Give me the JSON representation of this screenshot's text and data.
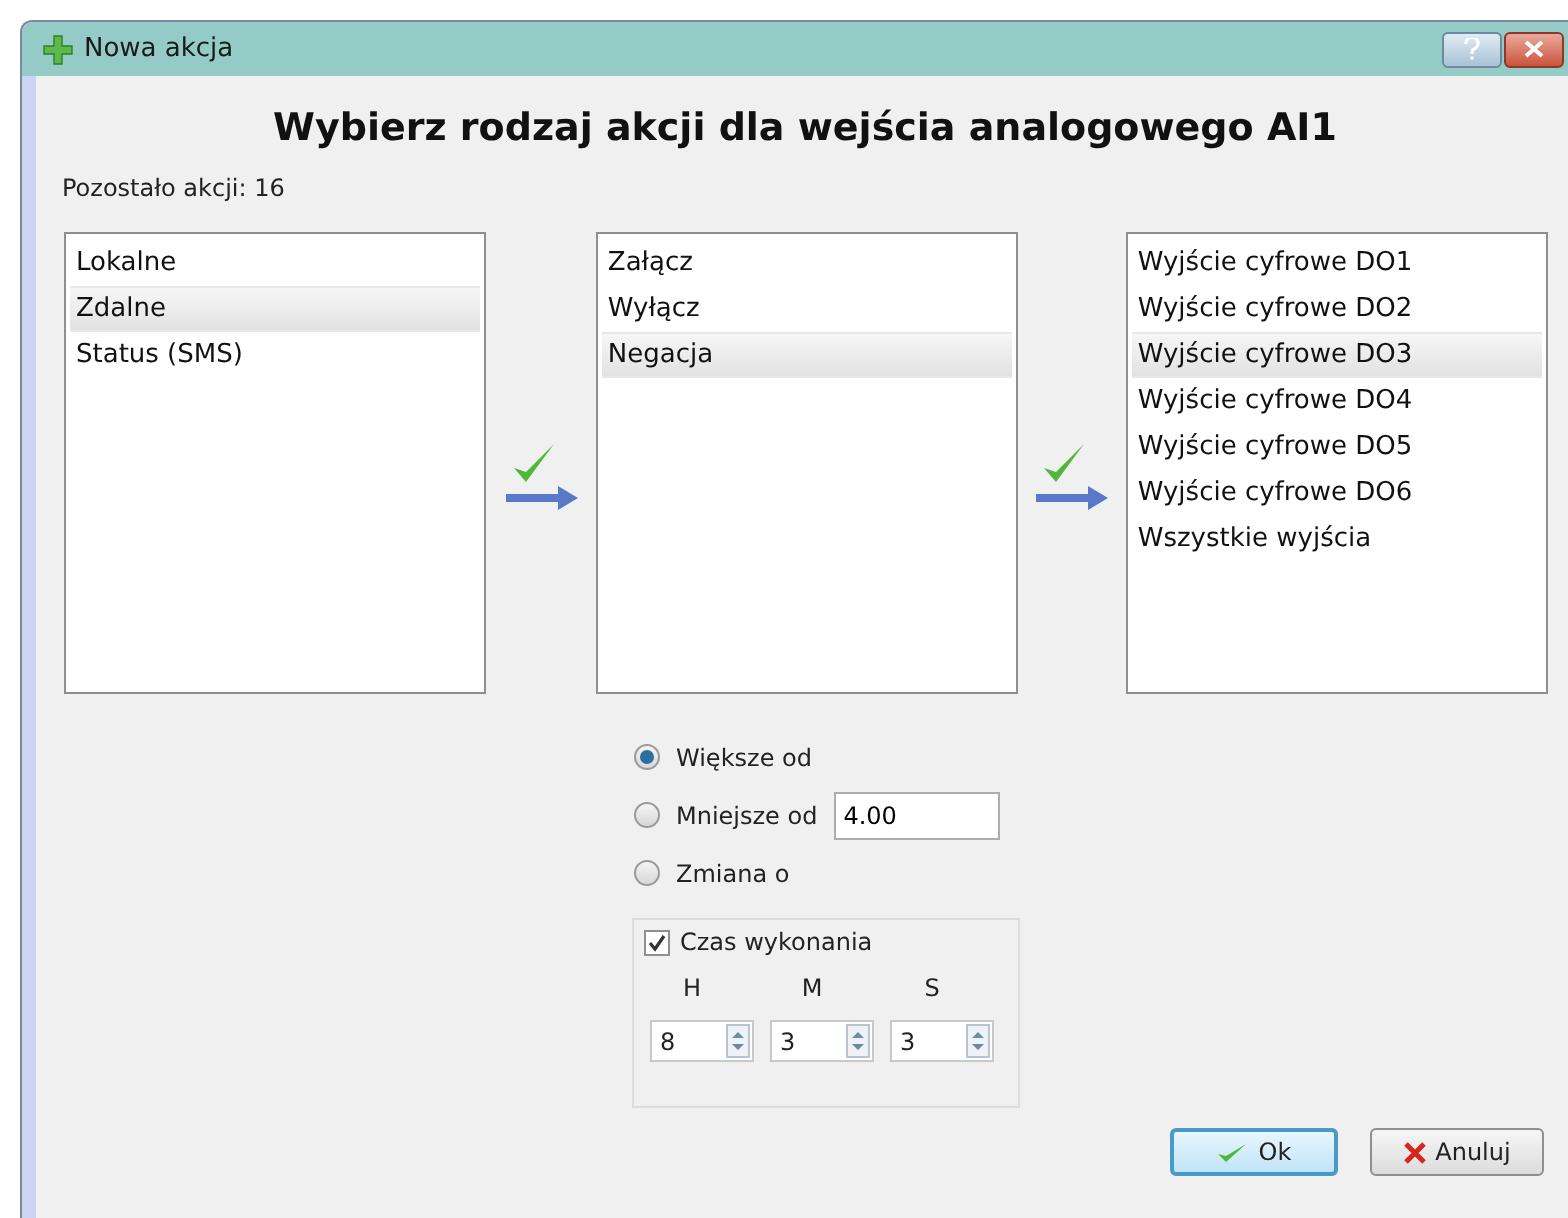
{
  "window": {
    "title": "Nowa akcja"
  },
  "heading": "Wybierz rodzaj akcji dla wejścia analogowego AI1",
  "remaining": "Pozostało akcji: 16",
  "lists": [
    {
      "items": [
        {
          "label": "Lokalne",
          "selected": false
        },
        {
          "label": "Zdalne",
          "selected": true
        },
        {
          "label": "Status (SMS)",
          "selected": false
        }
      ]
    },
    {
      "items": [
        {
          "label": "Załącz",
          "selected": false
        },
        {
          "label": "Wyłącz",
          "selected": false
        },
        {
          "label": "Negacja",
          "selected": true
        }
      ]
    },
    {
      "items": [
        {
          "label": "Wyjście cyfrowe DO1",
          "selected": false
        },
        {
          "label": "Wyjście cyfrowe DO2",
          "selected": false
        },
        {
          "label": "Wyjście cyfrowe DO3",
          "selected": true
        },
        {
          "label": "Wyjście cyfrowe DO4",
          "selected": false
        },
        {
          "label": "Wyjście cyfrowe DO5",
          "selected": false
        },
        {
          "label": "Wyjście cyfrowe DO6",
          "selected": false
        },
        {
          "label": "Wszystkie wyjścia",
          "selected": false
        }
      ]
    }
  ],
  "conditions": [
    {
      "label": "Większe od",
      "selected": true
    },
    {
      "label": "Mniejsze od",
      "selected": false,
      "value": "4.00"
    },
    {
      "label": "Zmiana o",
      "selected": false
    }
  ],
  "execution_time": {
    "label": "Czas wykonania",
    "checked": true,
    "fields": [
      {
        "label": "H",
        "value": "8"
      },
      {
        "label": "M",
        "value": "3"
      },
      {
        "label": "S",
        "value": "3"
      }
    ]
  },
  "buttons": [
    {
      "label": "Ok",
      "kind": "ok"
    },
    {
      "label": "Anuluj",
      "kind": "cancel"
    }
  ]
}
